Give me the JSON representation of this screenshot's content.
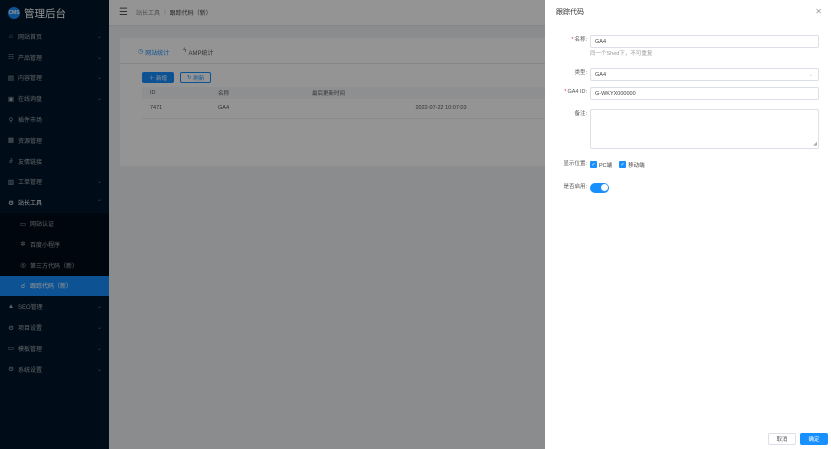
{
  "app": {
    "logo_mark": "CMS",
    "title": "管理后台"
  },
  "sidebar": {
    "items": [
      {
        "label": "网站首页",
        "icon": "home-icon"
      },
      {
        "label": "产品管理",
        "icon": "product-icon"
      },
      {
        "label": "内容管理",
        "icon": "content-icon"
      },
      {
        "label": "在线询盘",
        "icon": "inquiry-icon"
      },
      {
        "label": "插件市场",
        "icon": "plugin-icon"
      },
      {
        "label": "资源管理",
        "icon": "resource-icon"
      },
      {
        "label": "友情链接",
        "icon": "link-icon"
      },
      {
        "label": "工单管理",
        "icon": "ticket-icon"
      },
      {
        "label": "站长工具",
        "icon": "tools-icon"
      }
    ],
    "sub_items": [
      {
        "label": "网站认证"
      },
      {
        "label": "百度小程序"
      },
      {
        "label": "第三方代码（新）"
      },
      {
        "label": "跟踪代码（新）"
      }
    ],
    "bottom_items": [
      {
        "label": "SEO管理"
      },
      {
        "label": "项目设置"
      },
      {
        "label": "模板管理"
      },
      {
        "label": "系统设置"
      }
    ]
  },
  "header": {
    "crumb_root": "站长工具",
    "crumb_current": "跟踪代码（新）"
  },
  "main": {
    "tabs": [
      {
        "label": "网站统计"
      },
      {
        "label": "AMP统计"
      }
    ],
    "add_button": "新增",
    "refresh_button": "刷新",
    "table": {
      "headers": {
        "id": "ID",
        "name": "名称",
        "time": "最后更新时间"
      },
      "rows": [
        {
          "id": "7471",
          "name": "GA4",
          "time": "2022-07-22 10:07:03"
        }
      ]
    }
  },
  "drawer": {
    "title": "跟踪代码",
    "name_label": "名称:",
    "name_value": "GA4",
    "name_hint": "同一个Shed下，不可重复",
    "type_label": "类型:",
    "type_value": "GA4",
    "ga_label": "GA4 ID:",
    "ga_value": "G-WKYX000000",
    "remark_label": "备注:",
    "position_label": "显示位置:",
    "pc_label": "PC端",
    "mobile_label": "移动端",
    "enable_label": "是否启用:",
    "cancel_button": "取消",
    "ok_button": "确定"
  }
}
